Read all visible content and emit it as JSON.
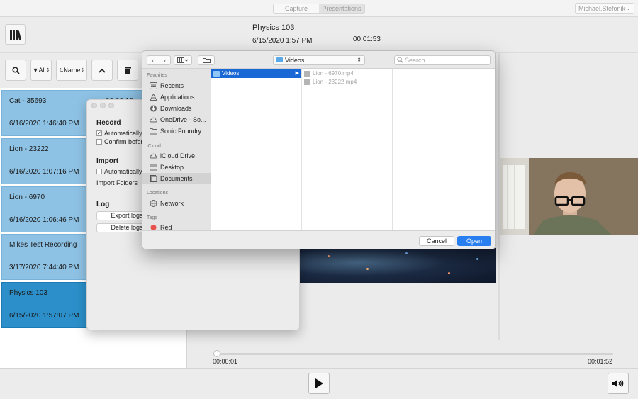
{
  "topbar": {
    "tabs": [
      "Capture",
      "Presentations"
    ],
    "active_tab": "Presentations",
    "user": "Michael.Stefonik"
  },
  "header": {
    "title": "Physics 103",
    "date": "6/15/2020 1:57 PM",
    "duration": "00:01:53"
  },
  "toolbar": {
    "filter_label": "All",
    "sort_label": "Name"
  },
  "recordings": [
    {
      "name": "Cat - 35693",
      "date": "6/16/2020 1:46:40 PM",
      "duration": "00:00:18",
      "selected": false
    },
    {
      "name": "Lion - 23222",
      "date": "6/16/2020 1:07:16 PM",
      "duration": "",
      "selected": false
    },
    {
      "name": "Lion - 6970",
      "date": "6/16/2020 1:06:46 PM",
      "duration": "",
      "selected": false
    },
    {
      "name": "Mikes Test Recording",
      "date": "3/17/2020 7:44:40 PM",
      "duration": "",
      "selected": false
    },
    {
      "name": "Physics 103",
      "date": "6/15/2020 1:57:07 PM",
      "duration": "",
      "selected": true
    }
  ],
  "settings": {
    "record_heading": "Record",
    "record_auto": "Automatically",
    "record_confirm": "Confirm befor",
    "import_heading": "Import",
    "import_auto": "Automatically",
    "import_folders": "Import Folders",
    "log_heading": "Log",
    "export_logs": "Export logs",
    "delete_logs": "Delete logs"
  },
  "file_dialog": {
    "location": "Videos",
    "search_placeholder": "Search",
    "favorites_heading": "Favorites",
    "favorites": [
      "Recents",
      "Applications",
      "Downloads",
      "OneDrive - So...",
      "Sonic Foundry"
    ],
    "icloud_heading": "iCloud",
    "icloud": [
      "iCloud Drive",
      "Desktop",
      "Documents"
    ],
    "locations_heading": "Locations",
    "locations": [
      "Network"
    ],
    "tags_heading": "Tags",
    "tags": [
      "Red"
    ],
    "column1": [
      "Videos"
    ],
    "column2": [
      "Lion - 6970.mp4",
      "Lion - 23222.mp4"
    ],
    "cancel": "Cancel",
    "open": "Open"
  },
  "player": {
    "current_time": "00:00:01",
    "total_time": "00:01:52",
    "progress": 0.01
  },
  "colors": {
    "item_bg": "#8ec2e4",
    "item_selected_bg": "#2c8fc9",
    "accent": "#2a7ff0",
    "tag_red": "#e8514b"
  }
}
